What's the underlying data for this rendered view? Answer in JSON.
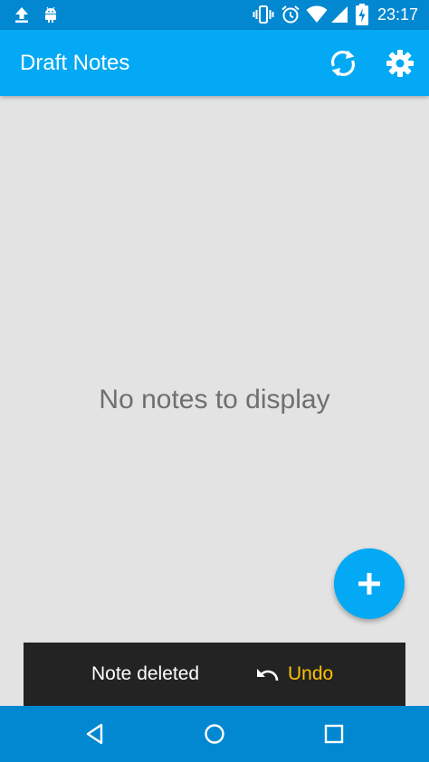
{
  "status_bar": {
    "time": "23:17",
    "icons": [
      "upload-icon",
      "android-icon",
      "vibrate-icon",
      "alarm-icon",
      "wifi-icon",
      "signal-icon",
      "battery-charging-icon"
    ]
  },
  "app_bar": {
    "title": "Draft Notes",
    "actions": [
      "sync-icon",
      "settings-gear-icon"
    ],
    "color": "#03a9f4"
  },
  "main": {
    "empty_message": "No notes to display",
    "background": "#e3e3e3"
  },
  "fab": {
    "icon": "plus-icon"
  },
  "snackbar": {
    "message": "Note deleted",
    "action_label": "Undo",
    "action_icon": "undo-icon",
    "action_color": "#ffc107"
  },
  "nav_bar": {
    "buttons": [
      "back-icon",
      "home-icon",
      "recents-icon"
    ]
  }
}
